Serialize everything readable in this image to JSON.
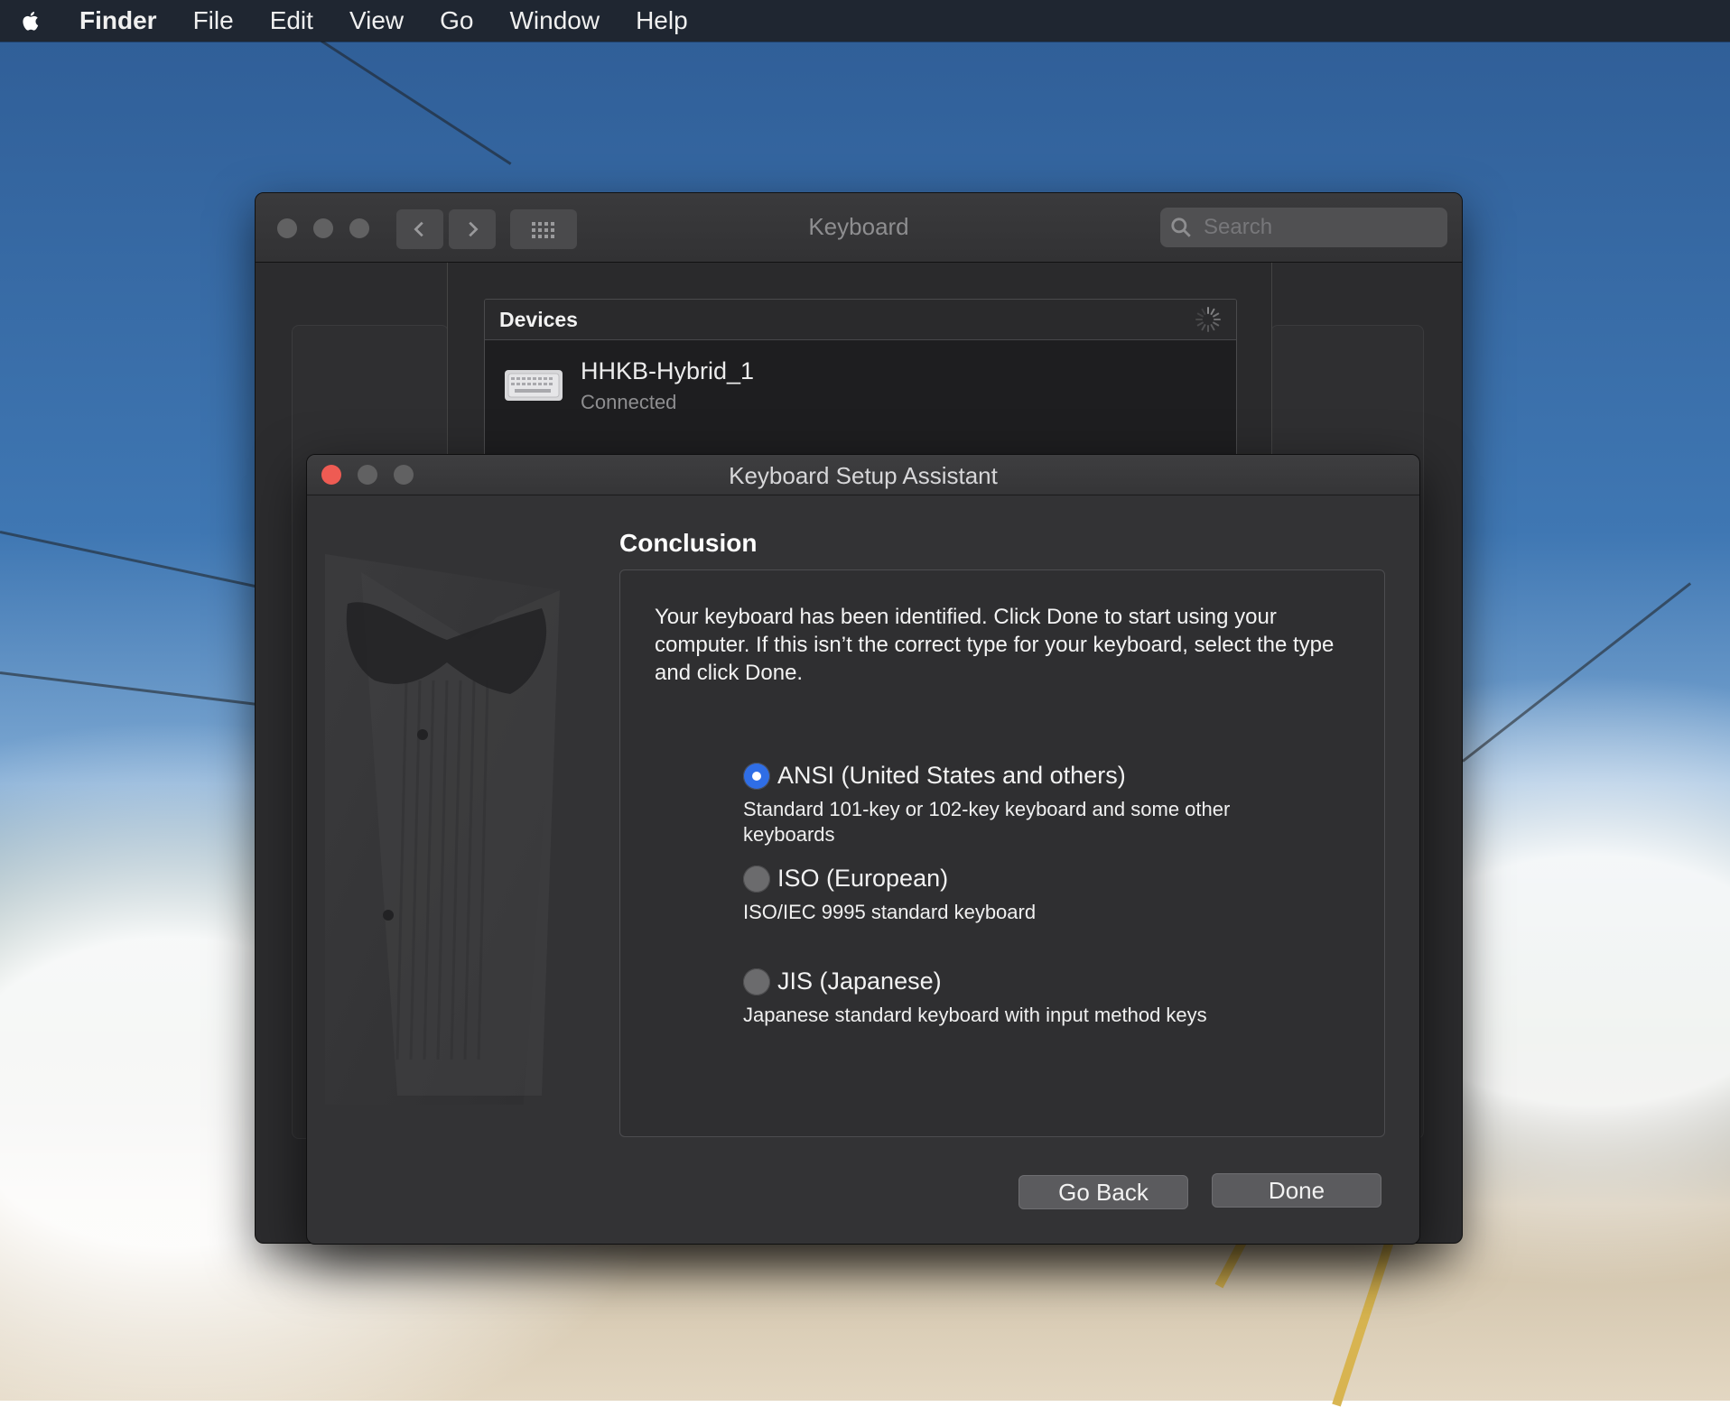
{
  "menubar": {
    "app": "Finder",
    "items": [
      "File",
      "Edit",
      "View",
      "Go",
      "Window",
      "Help"
    ]
  },
  "prefs_window": {
    "title": "Keyboard",
    "search_placeholder": "Search",
    "devices": {
      "header": "Devices",
      "device": {
        "name": "HHKB-Hybrid_1",
        "status": "Connected"
      }
    }
  },
  "assistant": {
    "title": "Keyboard Setup Assistant",
    "heading": "Conclusion",
    "message": "Your keyboard has been identified. Click Done to start using your computer. If this isn’t the correct type for your keyboard, select the type and click Done.",
    "options": [
      {
        "title": "ANSI (United States and others)",
        "desc": "Standard 101-key or 102-key keyboard and some other keyboards",
        "checked": true
      },
      {
        "title": "ISO (European)",
        "desc": "ISO/IEC 9995 standard keyboard",
        "checked": false
      },
      {
        "title": "JIS (Japanese)",
        "desc": "Japanese standard keyboard with input method keys",
        "checked": false
      }
    ],
    "buttons": {
      "back": "Go Back",
      "done": "Done"
    }
  },
  "colors": {
    "close": "#ee5b53",
    "accent": "#2f6ee6",
    "menubar": "#1f2631"
  }
}
